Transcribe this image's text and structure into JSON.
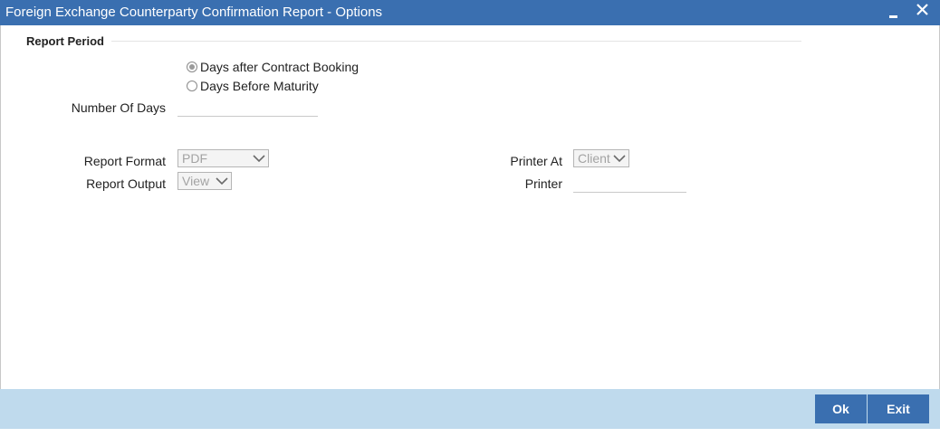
{
  "window": {
    "title": "Foreign Exchange Counterparty Confirmation Report - Options",
    "minimize_icon": "minimize-icon",
    "close_icon": "close-icon"
  },
  "report_period": {
    "heading": "Report Period",
    "options": [
      {
        "label": "Days after Contract Booking",
        "selected": true
      },
      {
        "label": "Days Before Maturity",
        "selected": false
      }
    ],
    "number_of_days_label": "Number Of Days",
    "number_of_days_value": ""
  },
  "report_format": {
    "label": "Report Format",
    "value": "PDF"
  },
  "report_output": {
    "label": "Report Output",
    "value": "View"
  },
  "printer_at": {
    "label": "Printer At",
    "value": "Client"
  },
  "printer": {
    "label": "Printer",
    "value": ""
  },
  "footer": {
    "ok_label": "Ok",
    "exit_label": "Exit"
  },
  "colors": {
    "titlebar": "#3a6fb0",
    "footer": "#bfdaed",
    "button": "#3a6fb0"
  }
}
